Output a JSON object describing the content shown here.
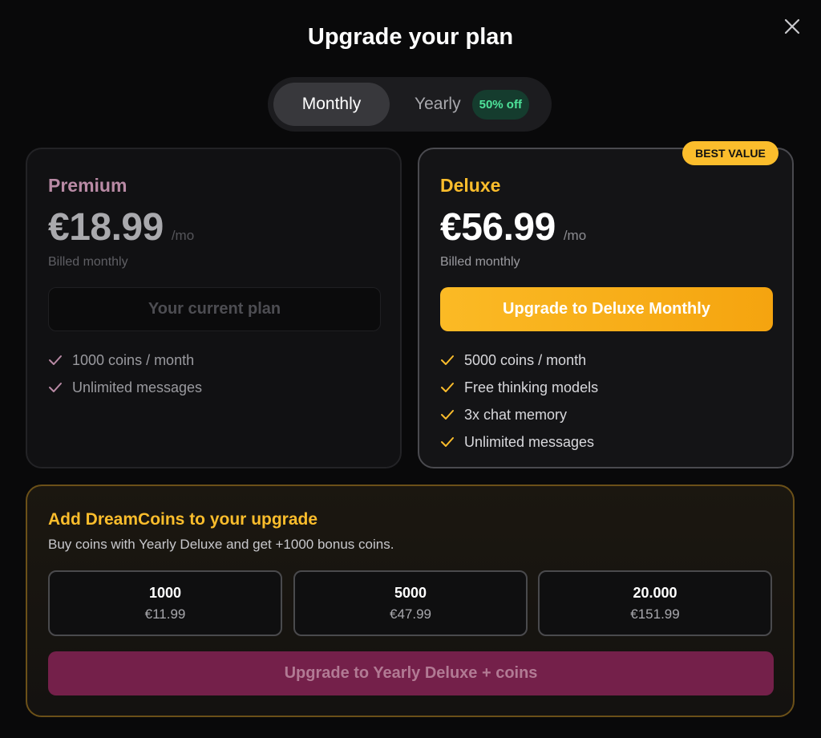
{
  "header": {
    "title": "Upgrade your plan",
    "close_icon": "close-icon"
  },
  "billing_toggle": {
    "monthly_label": "Monthly",
    "yearly_label": "Yearly",
    "discount_badge": "50% off",
    "selected": "Monthly"
  },
  "plans": [
    {
      "name": "Premium",
      "price": "€18.99",
      "period": "/mo",
      "billing": "Billed monthly",
      "cta_label": "Your current plan",
      "features": [
        "1000 coins / month",
        "Unlimited messages"
      ],
      "accent_color": "#b98aa5"
    },
    {
      "name": "Deluxe",
      "badge": "BEST VALUE",
      "price": "€56.99",
      "period": "/mo",
      "billing": "Billed monthly",
      "cta_label": "Upgrade to Deluxe Monthly",
      "features": [
        "5000 coins / month",
        "Free thinking models",
        "3x chat memory",
        "Unlimited messages"
      ],
      "accent_color": "#fbbd2c"
    }
  ],
  "coins": {
    "title": "Add DreamCoins to your upgrade",
    "subtitle": "Buy coins with Yearly Deluxe and get +1000 bonus coins.",
    "options": [
      {
        "amount": "1000",
        "price": "€11.99"
      },
      {
        "amount": "5000",
        "price": "€47.99"
      },
      {
        "amount": "20.000",
        "price": "€151.99"
      }
    ],
    "cta_label": "Upgrade to Yearly Deluxe + coins"
  }
}
